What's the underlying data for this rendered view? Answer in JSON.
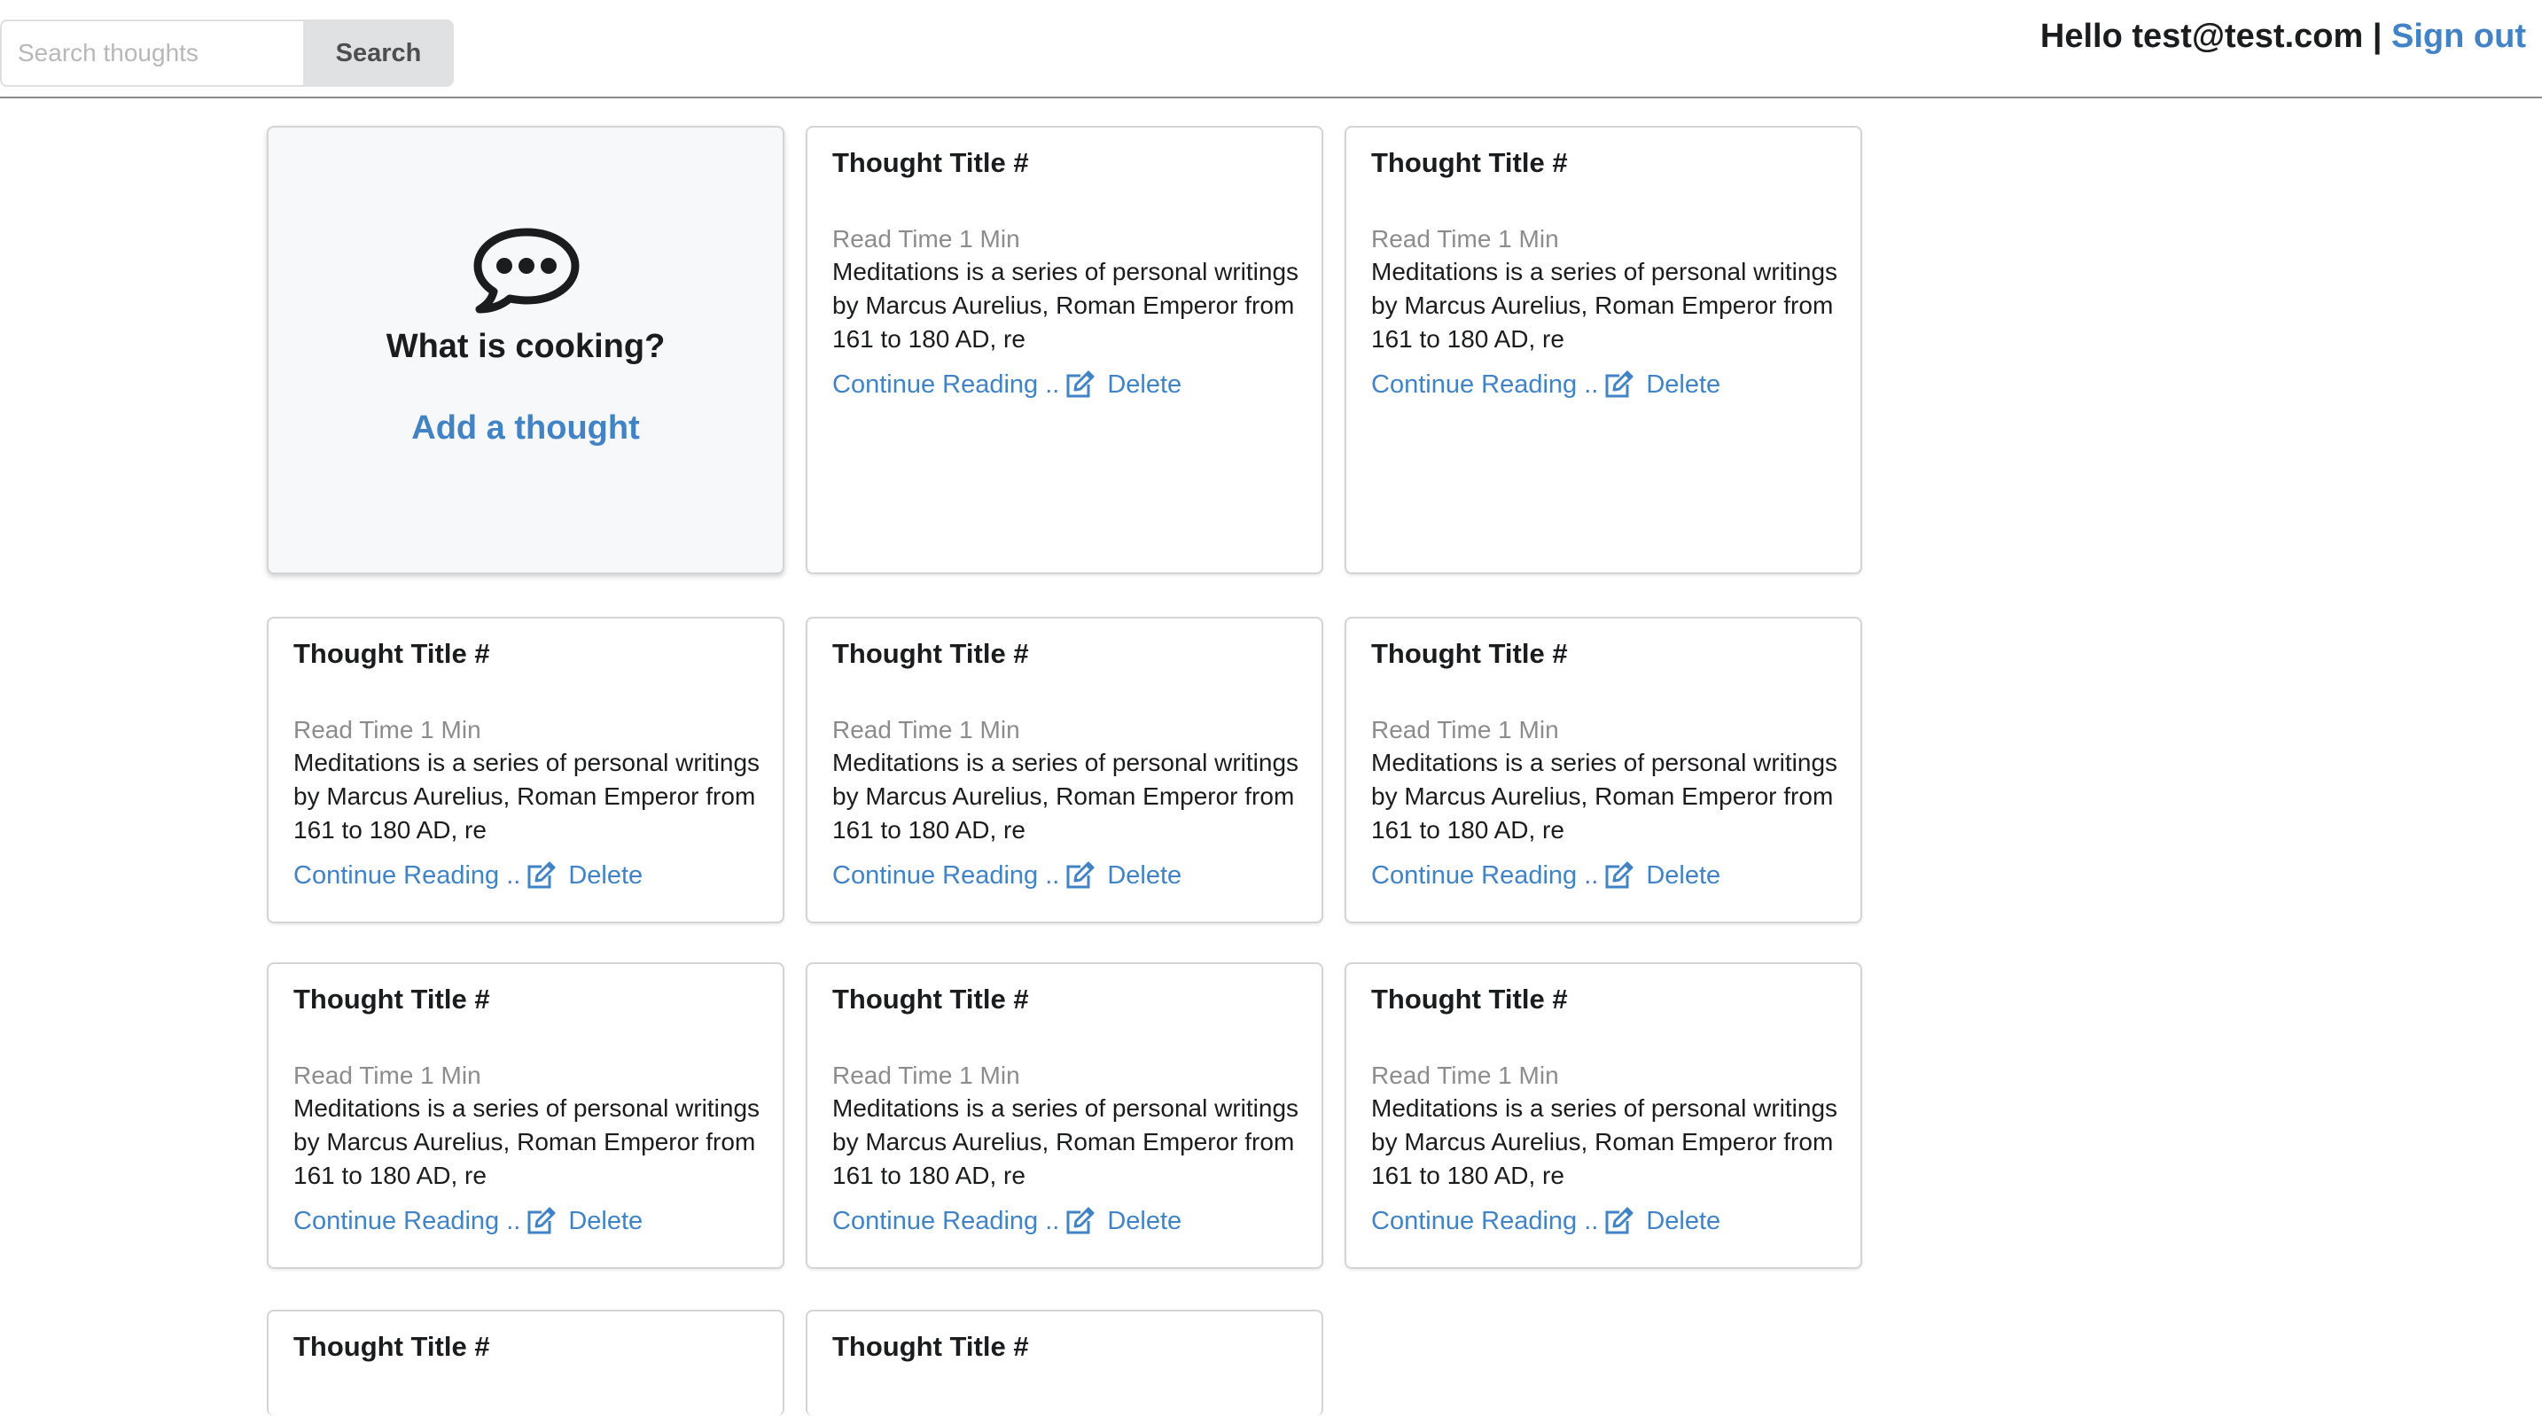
{
  "header": {
    "search_placeholder": "Search thoughts",
    "search_value": "",
    "search_button_label": "Search",
    "greeting": "Hello test@test.com |",
    "sign_out_label": "Sign out"
  },
  "add_card": {
    "icon": "chat-bubble-ellipsis-icon",
    "heading": "What is cooking?",
    "link_label": "Add a thought"
  },
  "thoughts": [
    {
      "title": "Thought Title #",
      "read_time": "Read Time 1 Min",
      "excerpt": "Meditations is a series of personal writings by Marcus Aurelius, Roman Emperor from 161 to 180 AD, re",
      "continue_label": "Continue Reading ..",
      "delete_label": "Delete"
    },
    {
      "title": "Thought Title #",
      "read_time": "Read Time 1 Min",
      "excerpt": "Meditations is a series of personal writings by Marcus Aurelius, Roman Emperor from 161 to 180 AD, re",
      "continue_label": "Continue Reading ..",
      "delete_label": "Delete"
    },
    {
      "title": "Thought Title #",
      "read_time": "Read Time 1 Min",
      "excerpt": "Meditations is a series of personal writings by Marcus Aurelius, Roman Emperor from 161 to 180 AD, re",
      "continue_label": "Continue Reading ..",
      "delete_label": "Delete"
    },
    {
      "title": "Thought Title #",
      "read_time": "Read Time 1 Min",
      "excerpt": "Meditations is a series of personal writings by Marcus Aurelius, Roman Emperor from 161 to 180 AD, re",
      "continue_label": "Continue Reading ..",
      "delete_label": "Delete"
    },
    {
      "title": "Thought Title #",
      "read_time": "Read Time 1 Min",
      "excerpt": "Meditations is a series of personal writings by Marcus Aurelius, Roman Emperor from 161 to 180 AD, re",
      "continue_label": "Continue Reading ..",
      "delete_label": "Delete"
    },
    {
      "title": "Thought Title #",
      "read_time": "Read Time 1 Min",
      "excerpt": "Meditations is a series of personal writings by Marcus Aurelius, Roman Emperor from 161 to 180 AD, re",
      "continue_label": "Continue Reading ..",
      "delete_label": "Delete"
    },
    {
      "title": "Thought Title #",
      "read_time": "Read Time 1 Min",
      "excerpt": "Meditations is a series of personal writings by Marcus Aurelius, Roman Emperor from 161 to 180 AD, re",
      "continue_label": "Continue Reading ..",
      "delete_label": "Delete"
    },
    {
      "title": "Thought Title #",
      "read_time": "Read Time 1 Min",
      "excerpt": "Meditations is a series of personal writings by Marcus Aurelius, Roman Emperor from 161 to 180 AD, re",
      "continue_label": "Continue Reading ..",
      "delete_label": "Delete"
    },
    {
      "title": "Thought Title #"
    },
    {
      "title": "Thought Title #"
    }
  ],
  "colors": {
    "link": "#4183c4",
    "text": "#1b1c1d",
    "muted": "#8c8c8c",
    "card_border": "#d4d4d5",
    "add_card_bg": "#f7f8fa",
    "search_button_bg": "#e0e1e2"
  }
}
